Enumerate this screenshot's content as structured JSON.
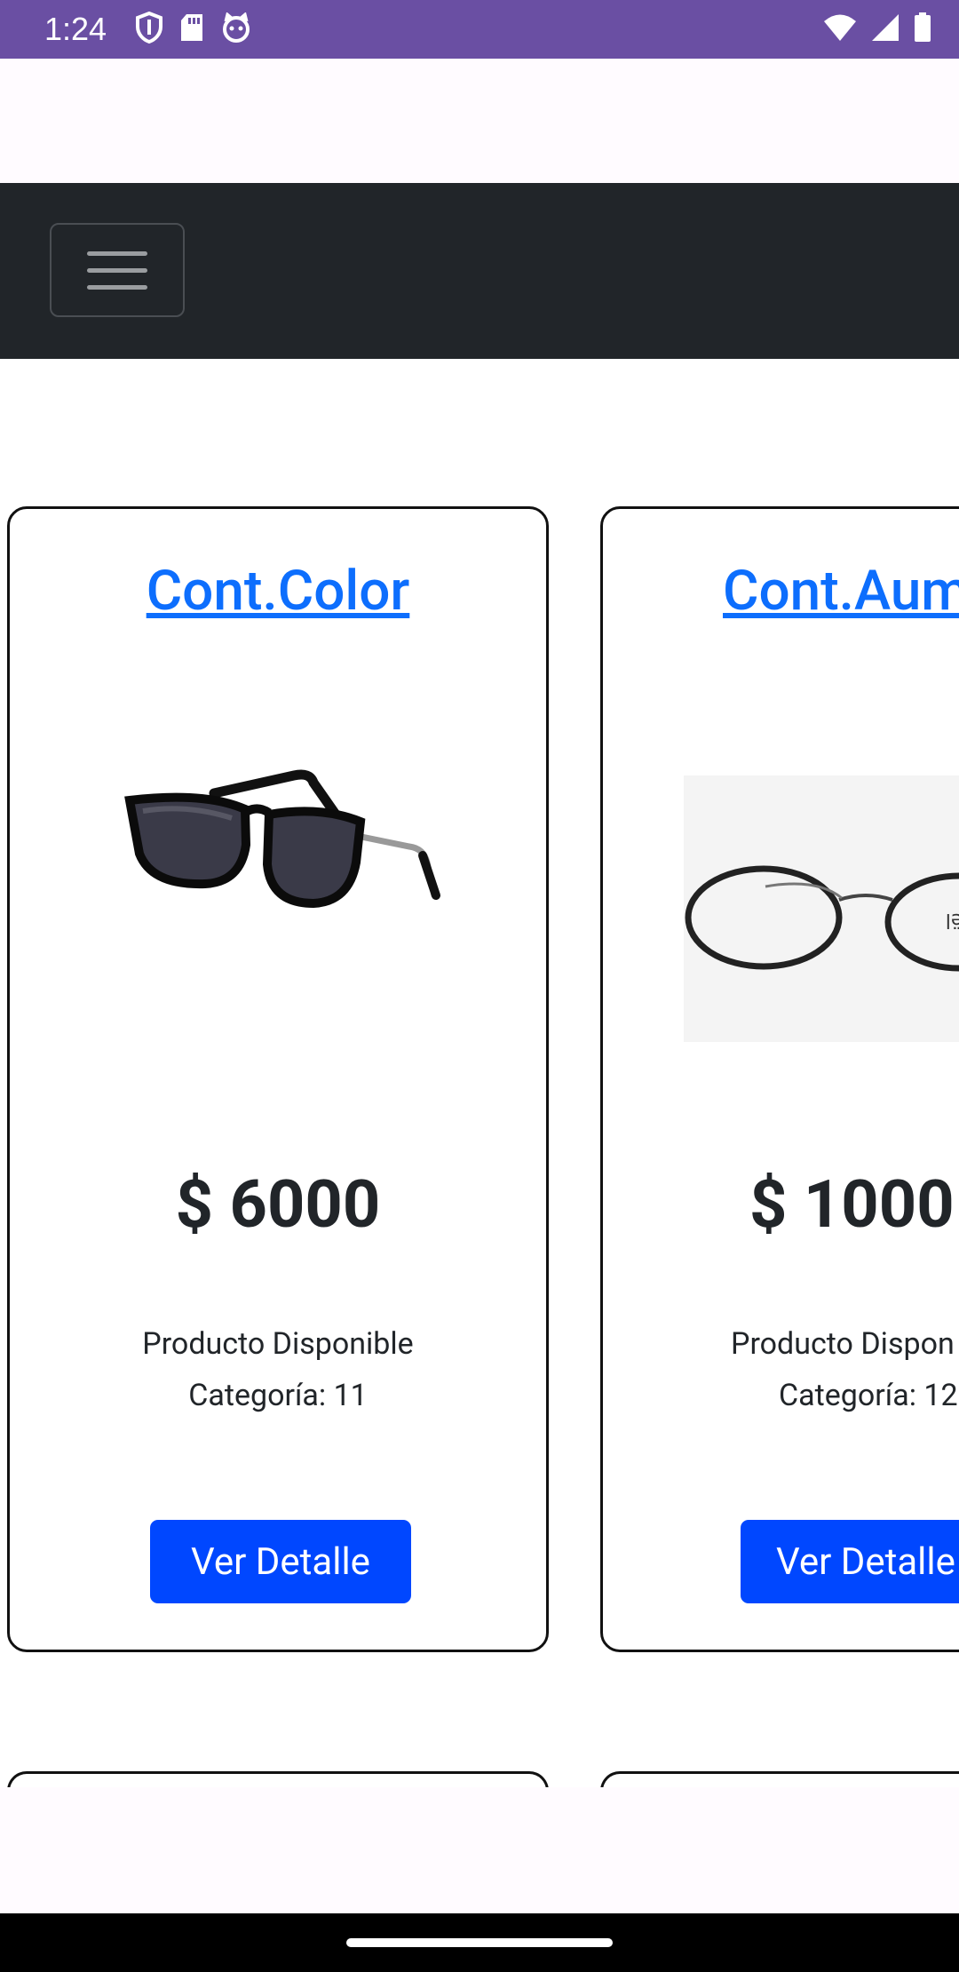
{
  "status_bar": {
    "time": "1:24",
    "left_icons": [
      "shield-icon",
      "sd-card-icon",
      "cat-face-icon"
    ],
    "right_icons": [
      "wifi-icon",
      "signal-icon",
      "battery-icon"
    ],
    "background_color": "#6a4fa3"
  },
  "navbar": {
    "toggler_icon": "hamburger-icon",
    "background_color": "#212529"
  },
  "products": [
    {
      "title": "Cont.Color",
      "image": "sunglasses-image",
      "price": "$ 6000",
      "status": "Producto Disponible",
      "category": "Categoría: 11",
      "button_label": "Ver Detalle"
    },
    {
      "title": "Cont.Aum",
      "image": "eyeglasses-image",
      "price": "$ 1000",
      "status": "Producto Dispon",
      "category": "Categoría: 12",
      "button_label": "Ver Detalle"
    }
  ],
  "colors": {
    "link": "#0d6efd",
    "button": "#0047ff"
  }
}
